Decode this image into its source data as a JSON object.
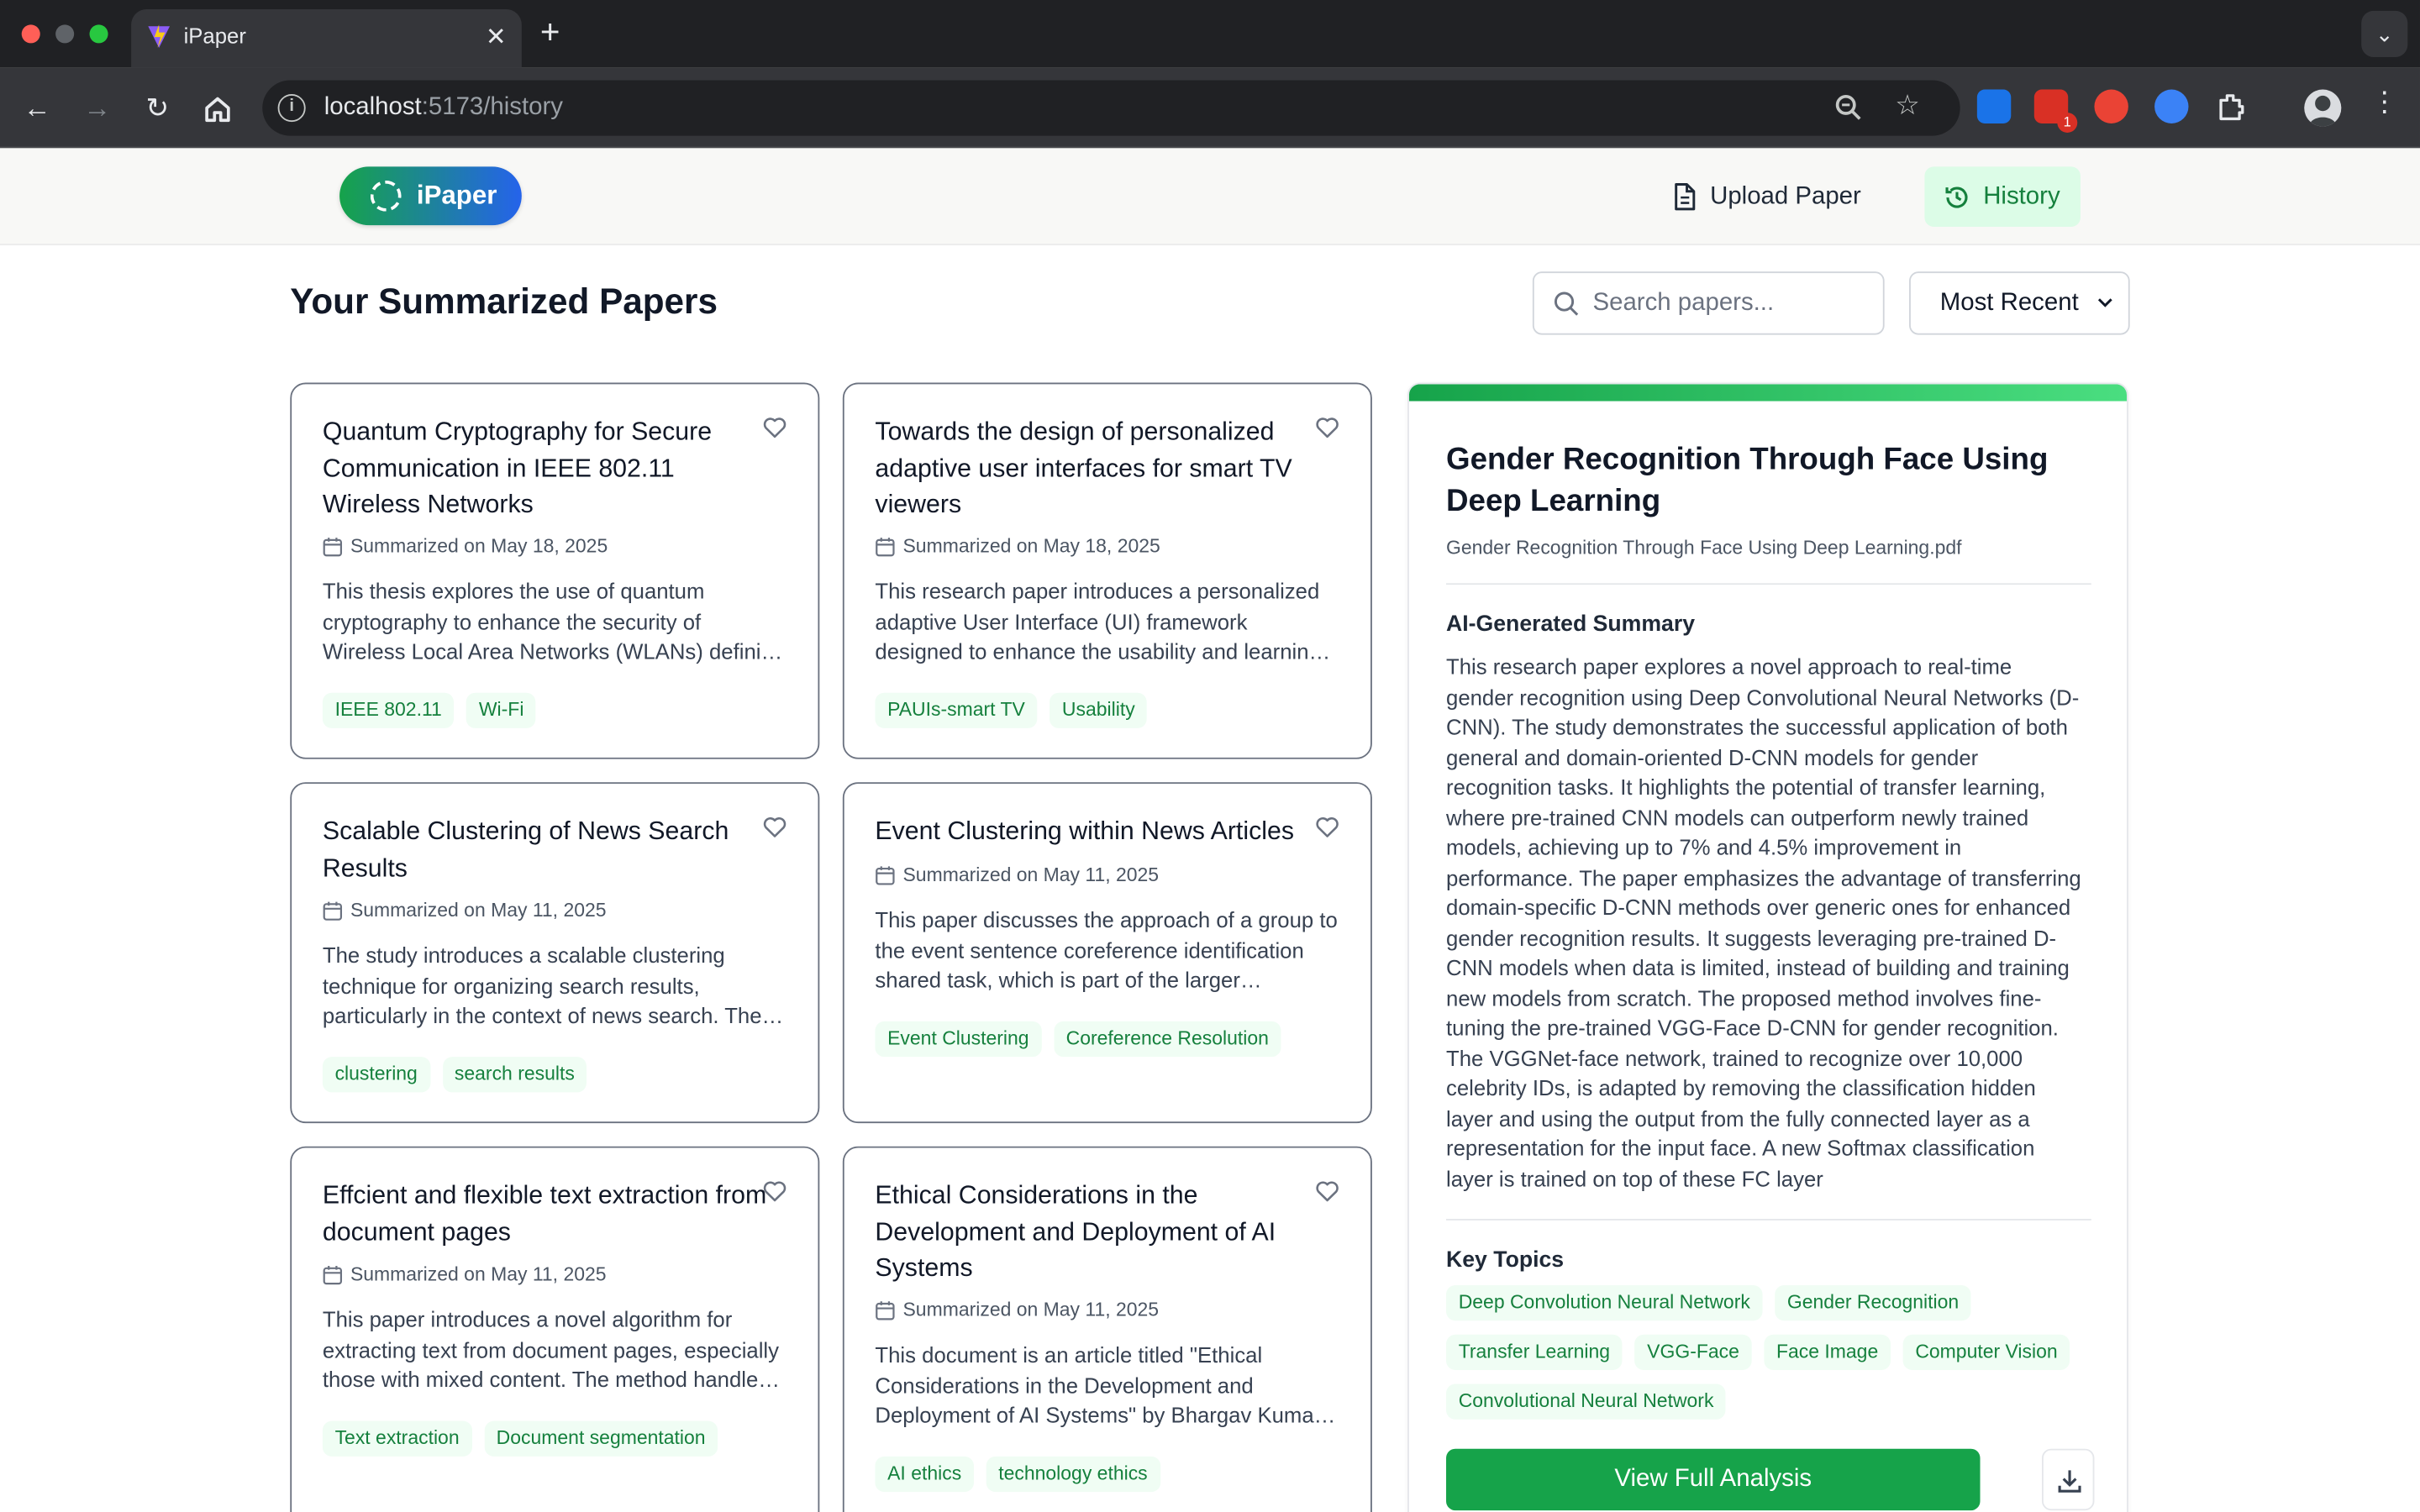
{
  "browser": {
    "tab_title": "iPaper",
    "url_host": "localhost",
    "url_path": ":5173/history",
    "notification_count": "1"
  },
  "header": {
    "logo_text": "iPaper",
    "upload_label": "Upload Paper",
    "history_label": "History"
  },
  "main": {
    "title": "Your Summarized Papers",
    "search_placeholder": "Search papers...",
    "sort_value": "Most Recent"
  },
  "papers": [
    {
      "title": "Quantum Cryptography for Secure Communication in IEEE 802.11 Wireless Networks",
      "date": "Summarized on May 18, 2025",
      "summary": "This thesis explores the use of quantum cryptography to enhance the security of Wireless Local Area Networks (WLANs) defining a new protocol for key distribution.",
      "tags": [
        "IEEE 802.11",
        "Wi-Fi"
      ]
    },
    {
      "title": "Towards the design of personalized adaptive user interfaces for smart TV viewers",
      "date": "Summarized on May 18, 2025",
      "summary": "This research paper introduces a personalized adaptive User Interface (UI) framework designed to enhance the usability and learning experience of smart TV viewers.",
      "tags": [
        "PAUIs-smart TV",
        "Usability"
      ]
    },
    {
      "title": "Scalable Clustering of News Search Results",
      "date": "Summarized on May 11, 2025",
      "summary": "The study introduces a scalable clustering technique for organizing search results, particularly in the context of news search. The approach groups related articles.",
      "tags": [
        "clustering",
        "search results"
      ]
    },
    {
      "title": "Event Clustering within News Articles",
      "date": "Summarized on May 11, 2025",
      "summary": "This paper discusses the approach of a group to the event sentence coreference identification shared task, which is part of the larger workshop challenge.",
      "tags": [
        "Event Clustering",
        "Coreference Resolution"
      ]
    },
    {
      "title": "Effcient and flexible text extraction from document pages",
      "date": "Summarized on May 11, 2025",
      "summary": "This paper introduces a novel algorithm for extracting text from document pages, especially those with mixed content. The method handles complex layouts.",
      "tags": [
        "Text extraction",
        "Document segmentation"
      ]
    },
    {
      "title": "Ethical Considerations in the Development and Deployment of AI Systems",
      "date": "Summarized on May 11, 2025",
      "summary": "This document is an article titled \"Ethical Considerations in the Development and Deployment of AI Systems\" by Bhargav Kumar and colleagues.",
      "tags": [
        "AI ethics",
        "technology ethics"
      ]
    }
  ],
  "detail": {
    "title": "Gender Recognition Through Face Using Deep Learning",
    "filename": "Gender Recognition Through Face Using Deep Learning.pdf",
    "summary_heading": "AI-Generated Summary",
    "summary": "This research paper explores a novel approach to real-time gender recognition using Deep Convolutional Neural Networks (D-CNN). The study demonstrates the successful application of both general and domain-oriented D-CNN models for gender recognition tasks. It highlights the potential of transfer learning, where pre-trained CNN models can outperform newly trained models, achieving up to 7% and 4.5% improvement in performance. The paper emphasizes the advantage of transferring domain-specific D-CNN methods over generic ones for enhanced gender recognition results. It suggests leveraging pre-trained D-CNN models when data is limited, instead of building and training new models from scratch. The proposed method involves fine-tuning the pre-trained VGG-Face D-CNN for gender recognition. The VGGNet-face network, trained to recognize over 10,000 celebrity IDs, is adapted by removing the classification hidden layer and using the output from the fully connected layer as a representation for the input face. A new Softmax classification layer is trained on top of these FC layer",
    "topics_heading": "Key Topics",
    "topics": [
      "Deep Convolution Neural Network",
      "Gender Recognition",
      "Transfer Learning",
      "VGG-Face",
      "Face Image",
      "Computer Vision",
      "Convolutional Neural Network"
    ],
    "view_button": "View Full Analysis"
  },
  "colors": {
    "brand_green": "#16a34a",
    "brand_blue": "#2563eb",
    "tag_bg": "#f0fdf4",
    "tag_text": "#15803d"
  },
  "icons": [
    "back-icon",
    "forward-icon",
    "reload-icon",
    "home-icon",
    "info-icon",
    "zoom-icon",
    "star-icon",
    "extensions-icon",
    "document-icon",
    "history-icon",
    "search-icon",
    "chevron-down-icon",
    "heart-icon",
    "calendar-icon",
    "download-icon"
  ]
}
